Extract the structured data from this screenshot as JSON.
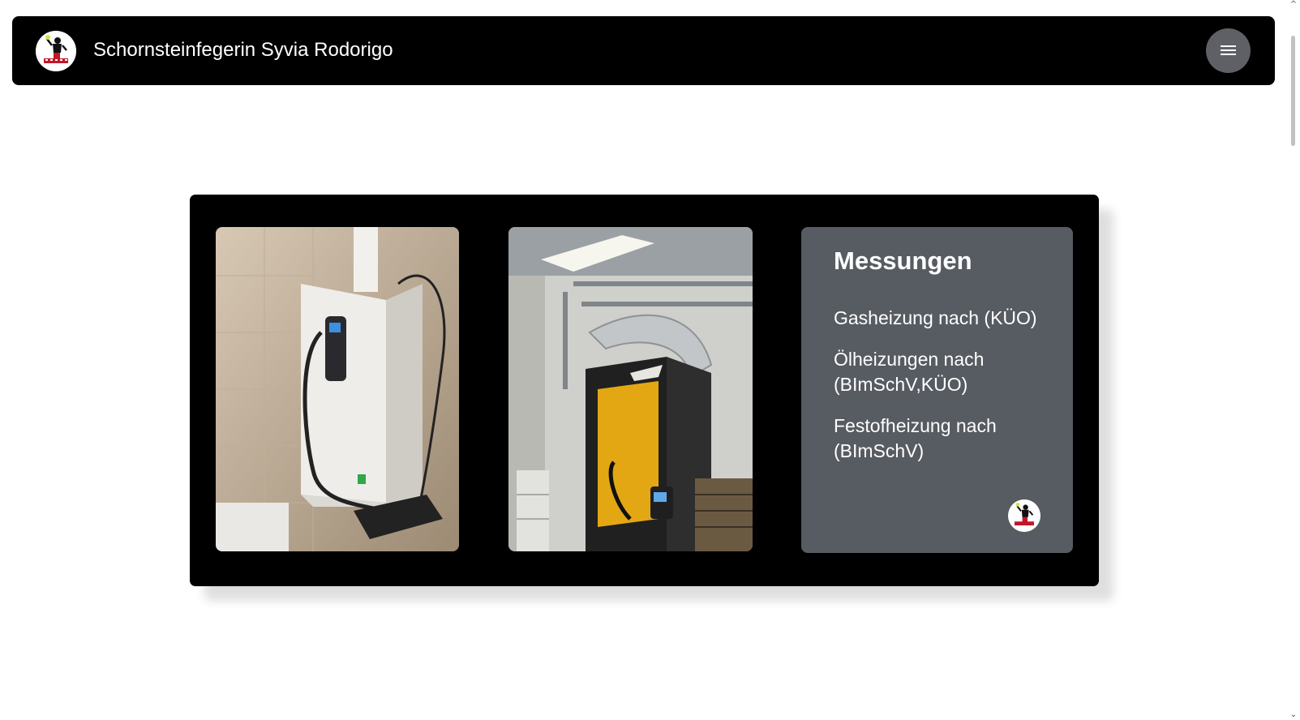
{
  "header": {
    "title": "Schornsteinfegerin Syvia Rodorigo",
    "logo": "chimney-sweep-logo",
    "menu_icon": "hamburger-menu-icon"
  },
  "gallery": {
    "photos": [
      {
        "description": "wall-mounted gas boiler with measurement probe",
        "icon": "boiler-photo"
      },
      {
        "description": "yellow solid-fuel boiler with flue pipe in basement",
        "icon": "solid-fuel-boiler-photo"
      }
    ]
  },
  "info": {
    "title": "Messungen",
    "items": [
      "Gasheizung nach (KÜO)",
      "Ölheizungen nach (BImSchV,KÜO)",
      "Festofheizung nach (BImSchV)"
    ],
    "logo": "chimney-sweep-logo"
  },
  "colors": {
    "navbar": "#000000",
    "menu_button": "#5e6066",
    "info_box": "#575b62",
    "text": "#ffffff"
  }
}
